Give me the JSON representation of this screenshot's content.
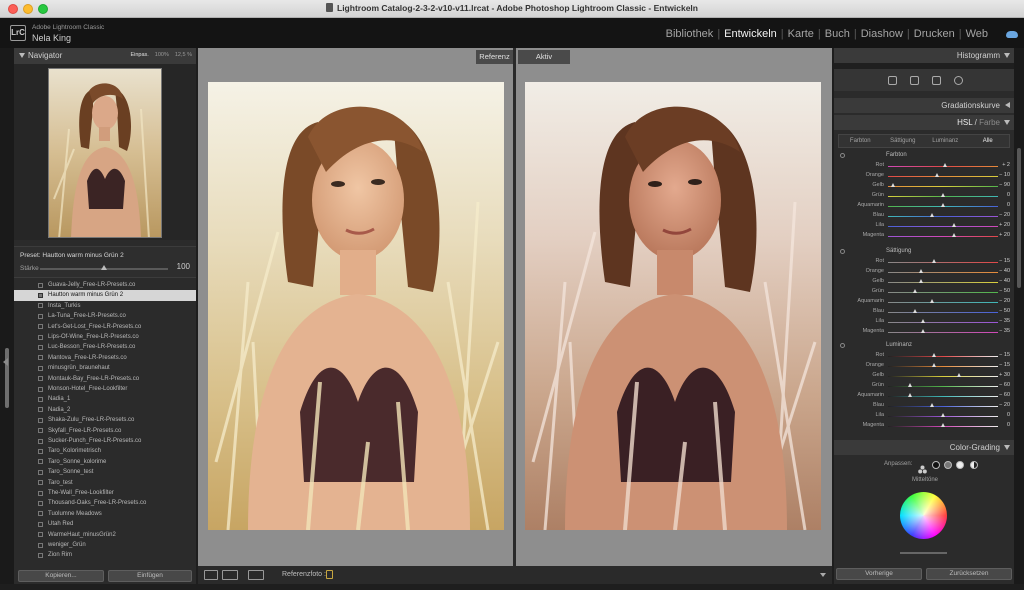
{
  "window": {
    "title": "Lightroom Catalog-2-3-2-v10-v11.lrcat - Adobe Photoshop Lightroom Classic - Entwickeln"
  },
  "identity": {
    "logo": "LrC",
    "app_name": "Adobe Lightroom Classic",
    "user": "Nela King"
  },
  "modules": [
    "Bibliothek",
    "Entwickeln",
    "Karte",
    "Buch",
    "Diashow",
    "Drucken",
    "Web"
  ],
  "active_module": "Entwickeln",
  "navigator": {
    "title": "Navigator",
    "zoom": [
      "Einpas.",
      "100%",
      "12,5 %"
    ],
    "active_zoom": "Einpas."
  },
  "preset_amount": {
    "preset_label": "Preset:",
    "preset_name": "Hautton warm minus Grün 2",
    "strength_label": "Stärke",
    "strength_value": "100",
    "strength_fraction": 0.5
  },
  "presets": [
    "Guava-Jelly_Free-LR-Presets.co",
    "Hautton warm minus Grün 2",
    "Insta_Turkis",
    "La-Tuna_Free-LR-Presets.co",
    "Let's-Get-Lost_Free-LR-Presets.co",
    "Lips-Of-Wine_Free-LR-Presets.co",
    "Luc-Besson_Free-LR-Presets.co",
    "Mantova_Free-LR-Presets.co",
    "minusgrün_braunehaut",
    "Montauk-Bay_Free-LR-Presets.co",
    "Monson-Hotel_Free-Lookfilter",
    "Nadia_1",
    "Nadia_2",
    "Shaka-Zulu_Free-LR-Presets.co",
    "Skyfall_Free-LR-Presets.co",
    "Sucker-Punch_Free-LR-Presets.co",
    "Taro_Kolorimetrisch",
    "Taro_Sonne_kolorime",
    "Taro_Sonne_test",
    "Taro_test",
    "The-Wall_Free-Lookfilter",
    "Thousand-Oaks_Free-LR-Presets.co",
    "Tuolumne Meadows",
    "Utah Red",
    "WarmeHaut_minusGrün2",
    "weniger_Grün",
    "Zion Rim"
  ],
  "selected_preset_index": 1,
  "left_buttons": {
    "copy": "Kopieren...",
    "paste": "Einfügen"
  },
  "compare": {
    "reference_tab": "Referenz",
    "active_tab": "Aktiv"
  },
  "toolbar": {
    "ref_photo_label": "Referenzfoto :"
  },
  "right_panel": {
    "histogram_title": "Histogramm",
    "tone_curve_title": "Gradationskurve",
    "hsl_title": "HSL",
    "hsl_title_sep": " / ",
    "color_title": "Farbe",
    "hsl_tabs": [
      "Farbton",
      "Sättigung",
      "Luminanz",
      "Alle"
    ],
    "active_hsl_tab": "Alle",
    "groups": [
      {
        "title": "Farbton",
        "rows": [
          {
            "label": "Rot",
            "value": "+ 2",
            "pos": 0.52
          },
          {
            "label": "Orange",
            "value": "− 10",
            "pos": 0.45
          },
          {
            "label": "Gelb",
            "value": "− 90",
            "pos": 0.05
          },
          {
            "label": "Grün",
            "value": "0",
            "pos": 0.5
          },
          {
            "label": "Aquamarin",
            "value": "0",
            "pos": 0.5
          },
          {
            "label": "Blau",
            "value": "− 20",
            "pos": 0.4
          },
          {
            "label": "Lila",
            "value": "+ 20",
            "pos": 0.6
          },
          {
            "label": "Magenta",
            "value": "+ 20",
            "pos": 0.6
          }
        ]
      },
      {
        "title": "Sättigung",
        "rows": [
          {
            "label": "Rot",
            "value": "− 15",
            "pos": 0.42
          },
          {
            "label": "Orange",
            "value": "− 40",
            "pos": 0.3
          },
          {
            "label": "Gelb",
            "value": "− 40",
            "pos": 0.3
          },
          {
            "label": "Grün",
            "value": "− 50",
            "pos": 0.25
          },
          {
            "label": "Aquamarin",
            "value": "− 20",
            "pos": 0.4
          },
          {
            "label": "Blau",
            "value": "− 50",
            "pos": 0.25
          },
          {
            "label": "Lila",
            "value": "− 35",
            "pos": 0.32
          },
          {
            "label": "Magenta",
            "value": "− 35",
            "pos": 0.32
          }
        ]
      },
      {
        "title": "Luminanz",
        "rows": [
          {
            "label": "Rot",
            "value": "− 15",
            "pos": 0.42
          },
          {
            "label": "Orange",
            "value": "− 15",
            "pos": 0.42
          },
          {
            "label": "Gelb",
            "value": "+ 30",
            "pos": 0.65
          },
          {
            "label": "Grün",
            "value": "− 60",
            "pos": 0.2
          },
          {
            "label": "Aquamarin",
            "value": "− 60",
            "pos": 0.2
          },
          {
            "label": "Blau",
            "value": "− 20",
            "pos": 0.4
          },
          {
            "label": "Lila",
            "value": "0",
            "pos": 0.5
          },
          {
            "label": "Magenta",
            "value": "0",
            "pos": 0.5
          }
        ]
      }
    ],
    "color_grading_title": "Color-Grading",
    "cg_mode_label": "Anpassen:",
    "cg_midtones_label": "Mitteltöne",
    "buttons": {
      "previous": "Vorherige",
      "reset": "Zurücksetzen"
    }
  },
  "colors": {
    "panel_bg": "#2b2b2b",
    "center_bg": "#8e8e8e",
    "hue_tracks": [
      "#e04848",
      "#e58a3a",
      "#d8cf3c",
      "#52b54c",
      "#3fb7b7",
      "#4a61d8",
      "#9b55d6",
      "#d148b8"
    ]
  }
}
